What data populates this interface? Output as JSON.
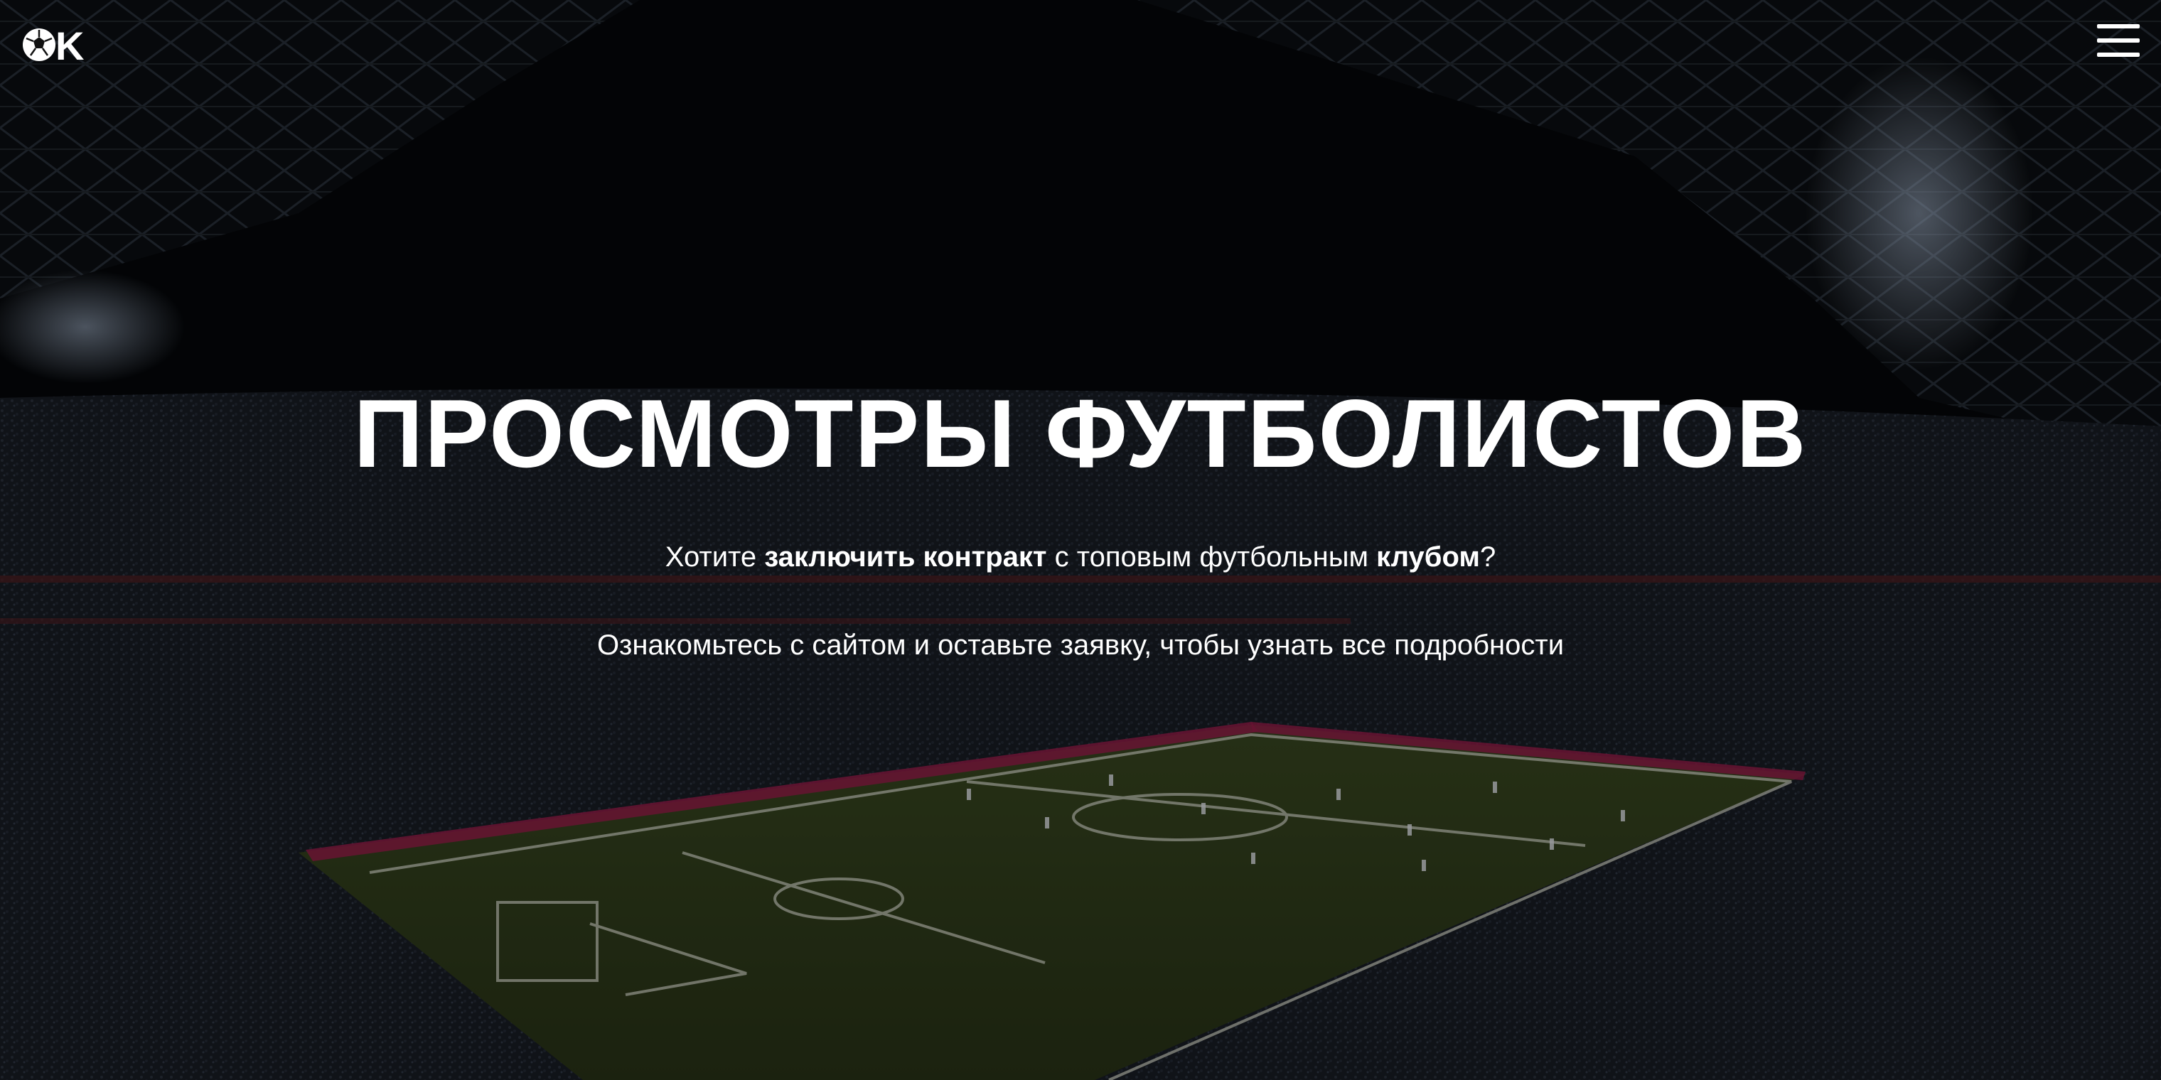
{
  "header": {
    "logo_letter": "K",
    "logo_icon": "soccer-ball-icon",
    "menu_icon": "hamburger-menu-icon"
  },
  "hero": {
    "title": "ПРОСМОТРЫ ФУТБОЛИСТОВ",
    "subtitle_1": {
      "part1": "Хотите ",
      "bold1": "заключить контракт",
      "part2": " с топовым футбольным ",
      "bold2": "клубом",
      "part3": "?"
    },
    "subtitle_2": "Ознакомьтесь с сайтом и оставьте заявку, чтобы узнать все подробности"
  },
  "colors": {
    "text": "#ffffff",
    "overlay": "#000000",
    "pitch": "#2d3a1a",
    "ad_boards": "#c0245a"
  }
}
